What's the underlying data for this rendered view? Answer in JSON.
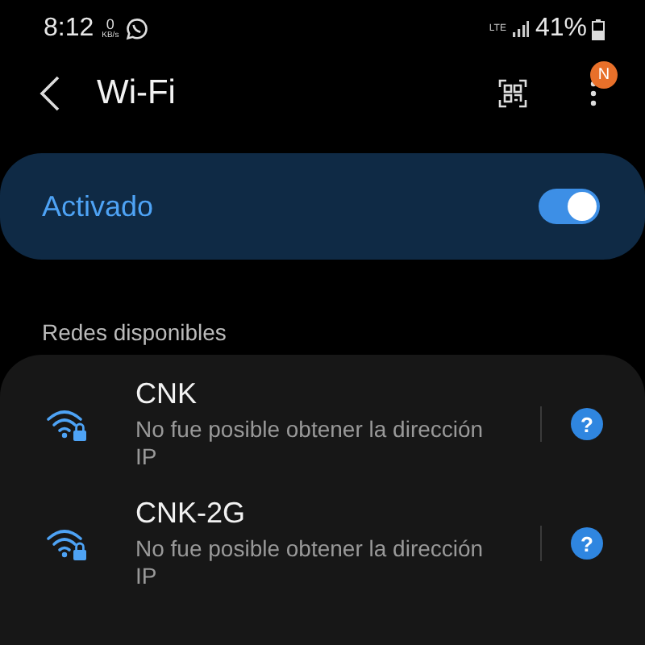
{
  "status_bar": {
    "time": "8:12",
    "net_speed_value": "0",
    "net_speed_unit": "KB/s",
    "network_type": "LTE",
    "battery": "41%"
  },
  "header": {
    "title": "Wi-Fi",
    "menu_badge": "N"
  },
  "master_switch": {
    "label": "Activado",
    "on": true
  },
  "section_title": "Redes disponibles",
  "networks": [
    {
      "name": "CNK",
      "status": "No fue posible obtener la dirección IP",
      "secured": true,
      "info": "?"
    },
    {
      "name": "CNK-2G",
      "status": "No fue posible obtener la dirección IP",
      "secured": true,
      "info": "?"
    }
  ]
}
